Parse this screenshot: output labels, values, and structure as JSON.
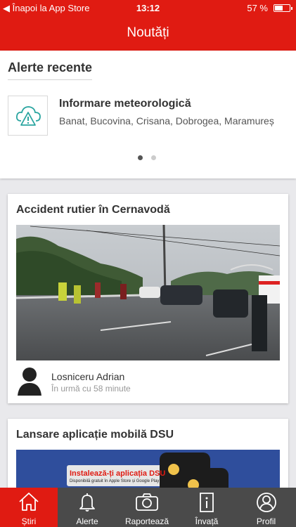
{
  "statusbar": {
    "back_label": "◀ Înapoi la App Store",
    "time": "13:12",
    "battery": "57 %",
    "battery_level": 0.57
  },
  "navbar": {
    "title": "Noutăți"
  },
  "alerts": {
    "heading": "Alerte recente",
    "items": [
      {
        "title": "Informare meteorologică",
        "description": "Banat, Bucovina, Crisana, Dobrogea, Maramureș"
      }
    ],
    "page_index": 1,
    "page_count": 2
  },
  "news": [
    {
      "title": "Accident rutier în Cernavodă",
      "author": "Losniceru Adrian",
      "time": "În urmă cu 58 minute"
    },
    {
      "title": "Lansare aplicație mobilă DSU",
      "banner_text": "Instalează-ți aplicația DSU",
      "banner_subtext": "Disponibilă gratuit în Apple Store și Google Play"
    }
  ],
  "tabs": [
    {
      "label": "Știri",
      "icon": "home-icon",
      "active": true
    },
    {
      "label": "Alerte",
      "icon": "bell-icon",
      "active": false
    },
    {
      "label": "Raportează",
      "icon": "camera-icon",
      "active": false
    },
    {
      "label": "Învață",
      "icon": "info-icon",
      "active": false
    },
    {
      "label": "Profil",
      "icon": "profile-icon",
      "active": false
    }
  ],
  "colors": {
    "primary": "#e01b12",
    "tabbar": "#4a4a4a",
    "alert_icon": "#2aa5a0"
  }
}
